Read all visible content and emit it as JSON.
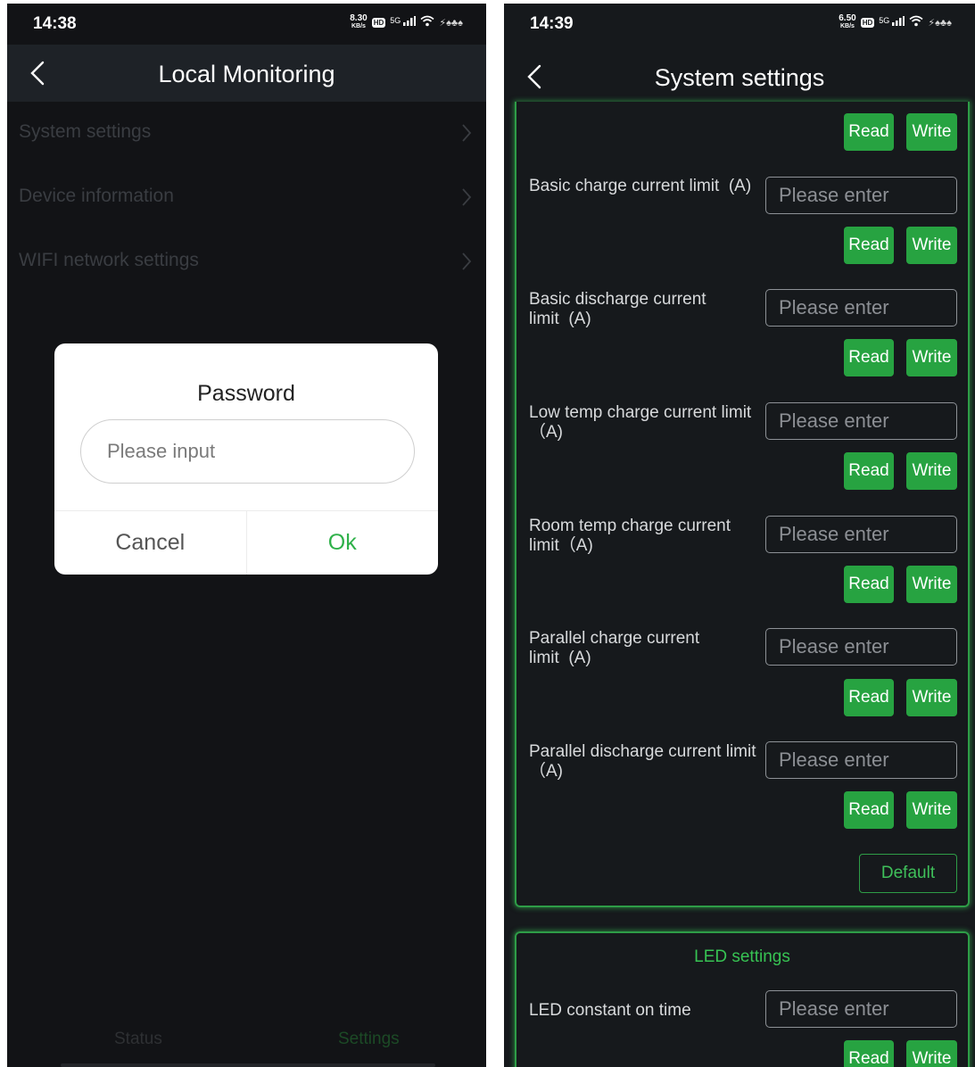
{
  "left_screen": {
    "status_bar": {
      "time": "14:38",
      "net_speed_value": "8.30",
      "net_speed_unit": "KB/s",
      "hd_badge": "HD",
      "signal_label": "5G"
    },
    "nav": {
      "title": "Local Monitoring"
    },
    "menu_items": [
      {
        "label": "System settings"
      },
      {
        "label": "Device information"
      },
      {
        "label": "WIFI network settings"
      }
    ],
    "dialog": {
      "title": "Password",
      "input_placeholder": "Please input",
      "cancel_label": "Cancel",
      "ok_label": "Ok"
    },
    "tabs": [
      {
        "label": "Status"
      },
      {
        "label": "Settings",
        "active": true
      }
    ]
  },
  "right_screen": {
    "status_bar": {
      "time": "14:39",
      "net_speed_value": "6.50",
      "net_speed_unit": "KB/s",
      "hd_badge": "HD",
      "signal_label": "5G"
    },
    "nav": {
      "title": "System settings"
    },
    "buttons": {
      "read": "Read",
      "write": "Write",
      "default": "Default"
    },
    "fields": [
      {
        "label": "Basic charge current limit  (A)",
        "placeholder": "Please enter"
      },
      {
        "label": "Basic discharge current limit  (A)",
        "placeholder": "Please enter"
      },
      {
        "label": "Low temp charge current limit（A)",
        "placeholder": "Please enter"
      },
      {
        "label": "Room temp charge current limit（A)",
        "placeholder": "Please enter"
      },
      {
        "label": "Parallel charge current limit  (A)",
        "placeholder": "Please enter"
      },
      {
        "label": "Parallel discharge current limit（A)",
        "placeholder": "Please enter"
      }
    ],
    "led_section": {
      "title": "LED settings",
      "fields": [
        {
          "label": "LED constant on time",
          "placeholder": "Please enter"
        }
      ]
    }
  },
  "colors": {
    "accent_green": "#27a341",
    "panel_border": "#2e9d47",
    "dark_bg": "#16191c"
  }
}
